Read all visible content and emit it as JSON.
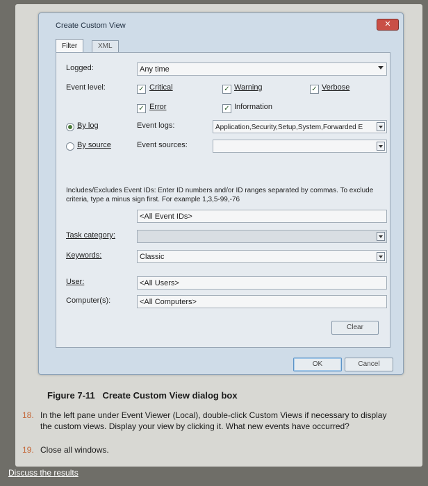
{
  "dialog": {
    "title": "Create Custom View",
    "close_glyph": "✕",
    "tabs": [
      "Filter",
      "XML"
    ],
    "logged": {
      "label": "Logged:",
      "value": "Any time"
    },
    "event_level": {
      "label": "Event level:",
      "options": [
        {
          "label": "Critical",
          "checked": true
        },
        {
          "label": "Warning",
          "checked": true
        },
        {
          "label": "Verbose",
          "checked": true
        },
        {
          "label": "Error",
          "checked": true
        },
        {
          "label": "Information",
          "checked": true
        }
      ]
    },
    "by_log": {
      "label": "By log",
      "selected": true
    },
    "by_source": {
      "label": "By source",
      "selected": false
    },
    "event_logs": {
      "label": "Event logs:",
      "value": "Application,Security,Setup,System,Forwarded E"
    },
    "event_sources": {
      "label": "Event sources:",
      "value": ""
    },
    "description": "Includes/Excludes Event IDs: Enter ID numbers and/or ID ranges separated by commas. To exclude criteria, type a minus sign first. For example 1,3,5-99,-76",
    "event_ids": {
      "value": "<All Event IDs>"
    },
    "task_category": {
      "label": "Task category:",
      "value": ""
    },
    "keywords": {
      "label": "Keywords:",
      "value": "Classic"
    },
    "user": {
      "label": "User:",
      "value": "<All Users>"
    },
    "computers": {
      "label": "Computer(s):",
      "value": "<All Computers>"
    },
    "clear_label": "Clear",
    "ok_label": "OK",
    "cancel_label": "Cancel",
    "check_glyph": "✓"
  },
  "figure": {
    "label": "Figure 7-11",
    "caption": "Create Custom View dialog box"
  },
  "steps": [
    {
      "num": "18.",
      "text": "In the left pane under Event Viewer (Local), double-click Custom Views if necessary to display the custom views. Display your view by clicking it. What new events have occurred?"
    },
    {
      "num": "19.",
      "text": "Close all windows."
    }
  ],
  "footer": {
    "link": "Discuss the results"
  }
}
